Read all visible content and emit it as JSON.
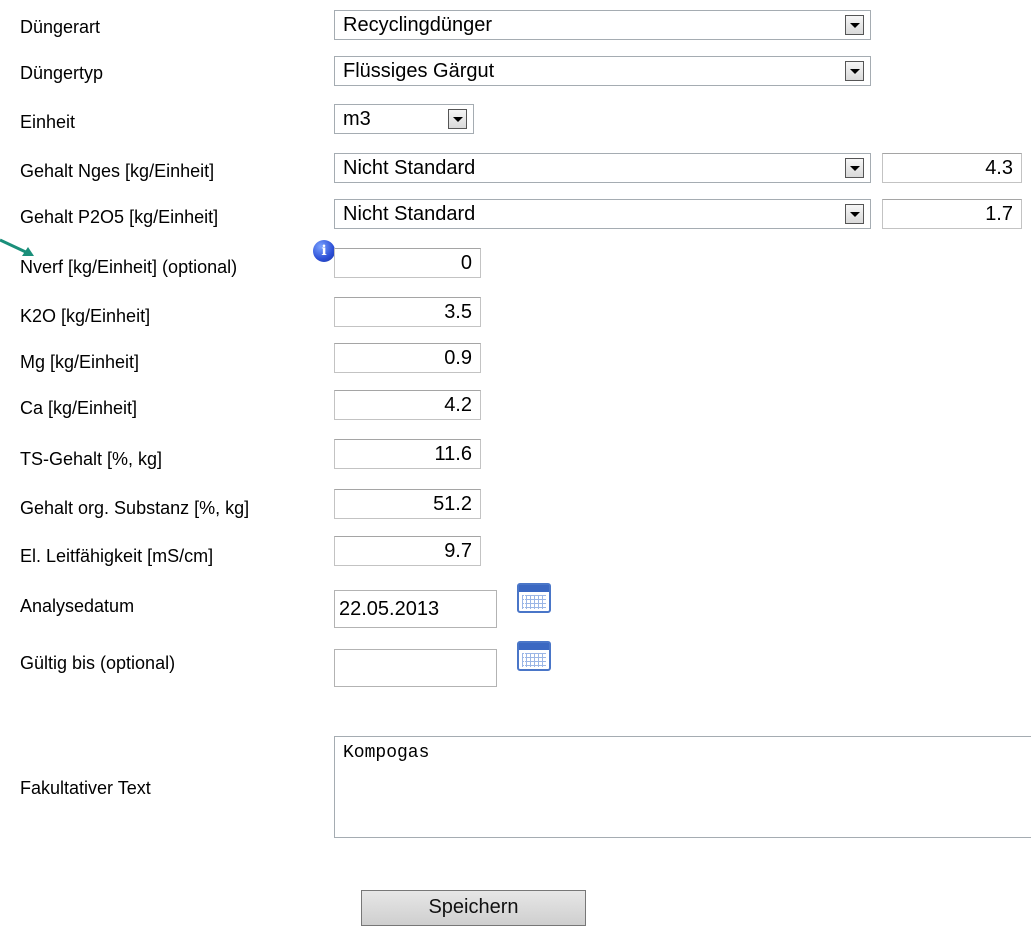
{
  "form": {
    "fields": {
      "duengerart": {
        "label": "Düngerart",
        "value": "Recyclingdünger"
      },
      "duengertyp": {
        "label": "Düngertyp",
        "value": "Flüssiges Gärgut"
      },
      "einheit": {
        "label": "Einheit",
        "value": "m3"
      },
      "gehalt_nges": {
        "label": "Gehalt Nges [kg/Einheit]",
        "select_value": "Nicht Standard",
        "value": "4.3"
      },
      "gehalt_p2o5": {
        "label": "Gehalt P2O5 [kg/Einheit]",
        "select_value": "Nicht Standard",
        "value": "1.7"
      },
      "nverf": {
        "label": "Nverf [kg/Einheit] (optional)",
        "value": "0"
      },
      "k2o": {
        "label": "K2O [kg/Einheit]",
        "value": "3.5"
      },
      "mg": {
        "label": "Mg [kg/Einheit]",
        "value": "0.9"
      },
      "ca": {
        "label": "Ca [kg/Einheit]",
        "value": "4.2"
      },
      "ts_gehalt": {
        "label": "TS-Gehalt [%, kg]",
        "value": "11.6"
      },
      "org_substanz": {
        "label": "Gehalt org. Substanz [%, kg]",
        "value": "51.2"
      },
      "leitfaehigkeit": {
        "label": "El. Leitfähigkeit [mS/cm]",
        "value": "9.7"
      },
      "analysedatum": {
        "label": "Analysedatum",
        "value": "22.05.2013"
      },
      "gueltig_bis": {
        "label": "Gültig bis (optional)",
        "value": ""
      },
      "fakultativer_text": {
        "label": "Fakultativer Text",
        "value": "Kompogas"
      }
    },
    "info_icon_glyph": "i",
    "save_label": "Speichern"
  },
  "colors": {
    "calendar_icon": "#3b68c2",
    "info_icon": "#2c4fd6",
    "pointer_arrow": "#1a8f7a"
  }
}
